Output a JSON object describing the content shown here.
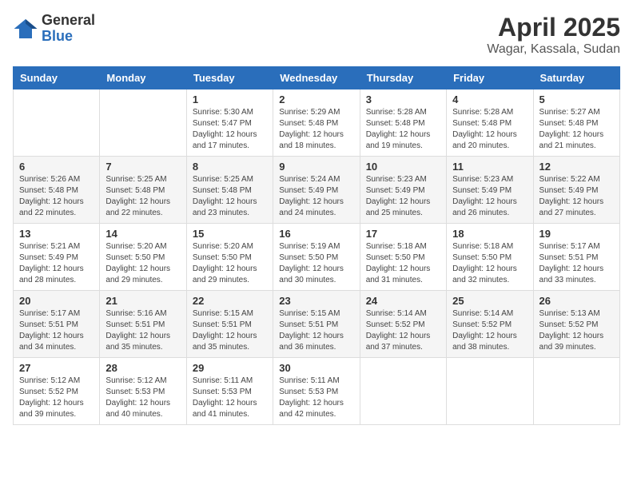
{
  "logo": {
    "general": "General",
    "blue": "Blue"
  },
  "header": {
    "month": "April 2025",
    "location": "Wagar, Kassala, Sudan"
  },
  "weekdays": [
    "Sunday",
    "Monday",
    "Tuesday",
    "Wednesday",
    "Thursday",
    "Friday",
    "Saturday"
  ],
  "weeks": [
    [
      {
        "day": null,
        "sunrise": null,
        "sunset": null,
        "daylight": null
      },
      {
        "day": null,
        "sunrise": null,
        "sunset": null,
        "daylight": null
      },
      {
        "day": "1",
        "sunrise": "Sunrise: 5:30 AM",
        "sunset": "Sunset: 5:47 PM",
        "daylight": "Daylight: 12 hours and 17 minutes."
      },
      {
        "day": "2",
        "sunrise": "Sunrise: 5:29 AM",
        "sunset": "Sunset: 5:48 PM",
        "daylight": "Daylight: 12 hours and 18 minutes."
      },
      {
        "day": "3",
        "sunrise": "Sunrise: 5:28 AM",
        "sunset": "Sunset: 5:48 PM",
        "daylight": "Daylight: 12 hours and 19 minutes."
      },
      {
        "day": "4",
        "sunrise": "Sunrise: 5:28 AM",
        "sunset": "Sunset: 5:48 PM",
        "daylight": "Daylight: 12 hours and 20 minutes."
      },
      {
        "day": "5",
        "sunrise": "Sunrise: 5:27 AM",
        "sunset": "Sunset: 5:48 PM",
        "daylight": "Daylight: 12 hours and 21 minutes."
      }
    ],
    [
      {
        "day": "6",
        "sunrise": "Sunrise: 5:26 AM",
        "sunset": "Sunset: 5:48 PM",
        "daylight": "Daylight: 12 hours and 22 minutes."
      },
      {
        "day": "7",
        "sunrise": "Sunrise: 5:25 AM",
        "sunset": "Sunset: 5:48 PM",
        "daylight": "Daylight: 12 hours and 22 minutes."
      },
      {
        "day": "8",
        "sunrise": "Sunrise: 5:25 AM",
        "sunset": "Sunset: 5:48 PM",
        "daylight": "Daylight: 12 hours and 23 minutes."
      },
      {
        "day": "9",
        "sunrise": "Sunrise: 5:24 AM",
        "sunset": "Sunset: 5:49 PM",
        "daylight": "Daylight: 12 hours and 24 minutes."
      },
      {
        "day": "10",
        "sunrise": "Sunrise: 5:23 AM",
        "sunset": "Sunset: 5:49 PM",
        "daylight": "Daylight: 12 hours and 25 minutes."
      },
      {
        "day": "11",
        "sunrise": "Sunrise: 5:23 AM",
        "sunset": "Sunset: 5:49 PM",
        "daylight": "Daylight: 12 hours and 26 minutes."
      },
      {
        "day": "12",
        "sunrise": "Sunrise: 5:22 AM",
        "sunset": "Sunset: 5:49 PM",
        "daylight": "Daylight: 12 hours and 27 minutes."
      }
    ],
    [
      {
        "day": "13",
        "sunrise": "Sunrise: 5:21 AM",
        "sunset": "Sunset: 5:49 PM",
        "daylight": "Daylight: 12 hours and 28 minutes."
      },
      {
        "day": "14",
        "sunrise": "Sunrise: 5:20 AM",
        "sunset": "Sunset: 5:50 PM",
        "daylight": "Daylight: 12 hours and 29 minutes."
      },
      {
        "day": "15",
        "sunrise": "Sunrise: 5:20 AM",
        "sunset": "Sunset: 5:50 PM",
        "daylight": "Daylight: 12 hours and 29 minutes."
      },
      {
        "day": "16",
        "sunrise": "Sunrise: 5:19 AM",
        "sunset": "Sunset: 5:50 PM",
        "daylight": "Daylight: 12 hours and 30 minutes."
      },
      {
        "day": "17",
        "sunrise": "Sunrise: 5:18 AM",
        "sunset": "Sunset: 5:50 PM",
        "daylight": "Daylight: 12 hours and 31 minutes."
      },
      {
        "day": "18",
        "sunrise": "Sunrise: 5:18 AM",
        "sunset": "Sunset: 5:50 PM",
        "daylight": "Daylight: 12 hours and 32 minutes."
      },
      {
        "day": "19",
        "sunrise": "Sunrise: 5:17 AM",
        "sunset": "Sunset: 5:51 PM",
        "daylight": "Daylight: 12 hours and 33 minutes."
      }
    ],
    [
      {
        "day": "20",
        "sunrise": "Sunrise: 5:17 AM",
        "sunset": "Sunset: 5:51 PM",
        "daylight": "Daylight: 12 hours and 34 minutes."
      },
      {
        "day": "21",
        "sunrise": "Sunrise: 5:16 AM",
        "sunset": "Sunset: 5:51 PM",
        "daylight": "Daylight: 12 hours and 35 minutes."
      },
      {
        "day": "22",
        "sunrise": "Sunrise: 5:15 AM",
        "sunset": "Sunset: 5:51 PM",
        "daylight": "Daylight: 12 hours and 35 minutes."
      },
      {
        "day": "23",
        "sunrise": "Sunrise: 5:15 AM",
        "sunset": "Sunset: 5:51 PM",
        "daylight": "Daylight: 12 hours and 36 minutes."
      },
      {
        "day": "24",
        "sunrise": "Sunrise: 5:14 AM",
        "sunset": "Sunset: 5:52 PM",
        "daylight": "Daylight: 12 hours and 37 minutes."
      },
      {
        "day": "25",
        "sunrise": "Sunrise: 5:14 AM",
        "sunset": "Sunset: 5:52 PM",
        "daylight": "Daylight: 12 hours and 38 minutes."
      },
      {
        "day": "26",
        "sunrise": "Sunrise: 5:13 AM",
        "sunset": "Sunset: 5:52 PM",
        "daylight": "Daylight: 12 hours and 39 minutes."
      }
    ],
    [
      {
        "day": "27",
        "sunrise": "Sunrise: 5:12 AM",
        "sunset": "Sunset: 5:52 PM",
        "daylight": "Daylight: 12 hours and 39 minutes."
      },
      {
        "day": "28",
        "sunrise": "Sunrise: 5:12 AM",
        "sunset": "Sunset: 5:53 PM",
        "daylight": "Daylight: 12 hours and 40 minutes."
      },
      {
        "day": "29",
        "sunrise": "Sunrise: 5:11 AM",
        "sunset": "Sunset: 5:53 PM",
        "daylight": "Daylight: 12 hours and 41 minutes."
      },
      {
        "day": "30",
        "sunrise": "Sunrise: 5:11 AM",
        "sunset": "Sunset: 5:53 PM",
        "daylight": "Daylight: 12 hours and 42 minutes."
      },
      {
        "day": null,
        "sunrise": null,
        "sunset": null,
        "daylight": null
      },
      {
        "day": null,
        "sunrise": null,
        "sunset": null,
        "daylight": null
      },
      {
        "day": null,
        "sunrise": null,
        "sunset": null,
        "daylight": null
      }
    ]
  ]
}
